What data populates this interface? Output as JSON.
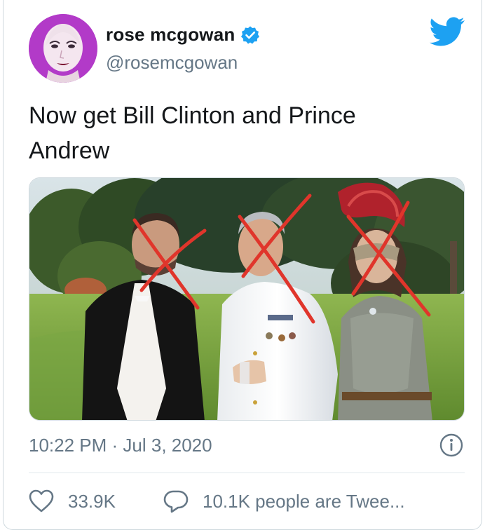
{
  "user": {
    "display_name": "rose mcgowan",
    "handle": "@rosemcgowan",
    "verified": true,
    "avatar_bg": "#b23ac8"
  },
  "tweet": {
    "text": "Now get Bill Clinton and Prince\nAndrew",
    "timestamp": "10:22 PM · Jul 3, 2020"
  },
  "stats": {
    "likes": "33.9K",
    "replies": "10.1K people are Twee..."
  },
  "colors": {
    "brand": "#1da1f2",
    "secondary_text": "#657786",
    "cross_mark": "#e0352b"
  },
  "icons": {
    "logo": "twitter-bird-icon",
    "verified": "verified-badge-icon",
    "info": "info-icon",
    "like": "heart-icon",
    "reply": "speech-bubble-icon"
  }
}
